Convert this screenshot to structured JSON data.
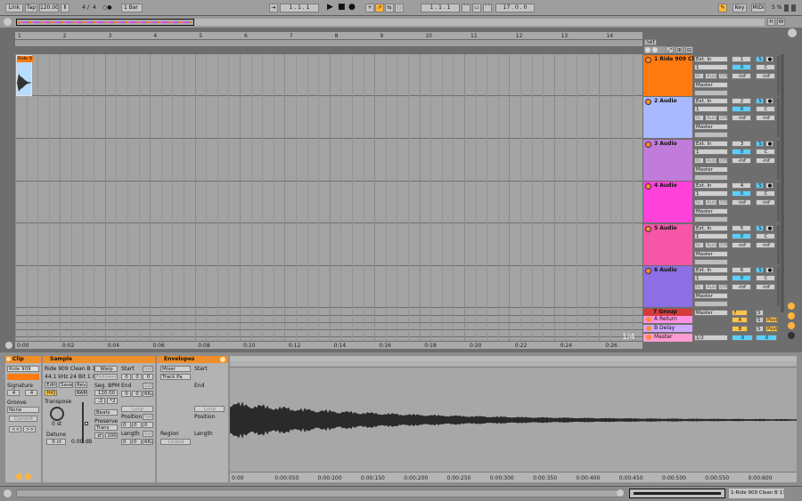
{
  "transport": {
    "link": "Link",
    "tap": "Tap",
    "tempo": "120.00",
    "sig_num": "4",
    "sig_sep": "/",
    "sig_den": "4",
    "metro": "○●",
    "quant": "1 Bar",
    "position": "1 .   1 .   1",
    "loop_start": "1 .   1 .   1",
    "loop_len": "17 .   0 .   0",
    "key": "Key",
    "midi": "MIDI",
    "cpu": "5 %",
    "h": "H",
    "w": "W"
  },
  "ruler": {
    "bars": [
      "1",
      "2",
      "3",
      "4",
      "5",
      "6",
      "7",
      "8",
      "9",
      "10",
      "11",
      "12",
      "13",
      "14"
    ],
    "times": [
      "0:00",
      "0:02",
      "0:04",
      "0:06",
      "0:08",
      "0:10",
      "0:12",
      "0:14",
      "0:16",
      "0:18",
      "0:20",
      "0:22",
      "0:24",
      "0:26"
    ],
    "set": "Set",
    "zoom": "1/4"
  },
  "clip_label": "Ride 9",
  "tracks": [
    {
      "name": "1 Ride 909 Cle",
      "color": "#ff7a10",
      "input": "Ext. In",
      "ch": "1",
      "num": "1",
      "vol": "0",
      "pan": "C",
      "inf1": "-inf",
      "inf2": "-inf",
      "out": "Master",
      "mon_in": "In",
      "mon_auto": "Auto",
      "mon_off": "Off"
    },
    {
      "name": "2 Audio",
      "color": "#a8b9ff",
      "input": "Ext. In",
      "ch": "1",
      "num": "2",
      "vol": "0",
      "pan": "C",
      "inf1": "-inf",
      "inf2": "-inf",
      "out": "Master",
      "mon_in": "In",
      "mon_auto": "Auto",
      "mon_off": "Off"
    },
    {
      "name": "3 Audio",
      "color": "#c07bdb",
      "input": "Ext. In",
      "ch": "1",
      "num": "3",
      "vol": "0",
      "pan": "C",
      "inf1": "-inf",
      "inf2": "-inf",
      "out": "Master",
      "mon_in": "In",
      "mon_auto": "Auto",
      "mon_off": "Off"
    },
    {
      "name": "4 Audio",
      "color": "#ff42d9",
      "input": "Ext. In",
      "ch": "1",
      "num": "4",
      "vol": "0",
      "pan": "C",
      "inf1": "-inf",
      "inf2": "-inf",
      "out": "Master",
      "mon_in": "In",
      "mon_auto": "Auto",
      "mon_off": "Off"
    },
    {
      "name": "5 Audio",
      "color": "#f556a6",
      "input": "Ext. In",
      "ch": "1",
      "num": "5",
      "vol": "0",
      "pan": "C",
      "inf1": "-inf",
      "inf2": "-inf",
      "out": "Master",
      "mon_in": "In",
      "mon_auto": "Auto",
      "mon_off": "Off"
    },
    {
      "name": "6 Audio",
      "color": "#8c6ee5",
      "input": "Ext. In",
      "ch": "1",
      "num": "6",
      "vol": "0",
      "pan": "C",
      "inf1": "-inf",
      "inf2": "-inf",
      "out": "Master",
      "mon_in": "In",
      "mon_auto": "Auto",
      "mon_off": "Off"
    }
  ],
  "group": {
    "name": "7 Group",
    "out": "Master",
    "num": "7",
    "s": "S"
  },
  "returns": [
    {
      "name": "A Return",
      "color": "#ff92e0",
      "letter": "A",
      "s": "S",
      "post": "Post"
    },
    {
      "name": "B Delay",
      "color": "#cfa9ff",
      "letter": "B",
      "s": "S",
      "post": "Post"
    }
  ],
  "master": {
    "name": "Master",
    "color": "#ff9bd2",
    "quant": "1/2",
    "vol": "0",
    "pan": "0"
  },
  "solo": "S",
  "clip": {
    "title": "Clip",
    "name": "Ride 909 Clea",
    "signature": "Signature",
    "sig_num": "4",
    "sig_den": "4",
    "groove": "Groove",
    "groove_val": "None",
    "commit": "Commit"
  },
  "sample": {
    "title": "Sample",
    "name": "Ride 909 Clean B 13",
    "info": "44.1 kHz 24 Bit 1 Ch",
    "warp": "Warp",
    "follower": "Follower",
    "edit": "Edit",
    "save": "Save",
    "rev": "Rev.",
    "seg_bpm": "Seg. BPM",
    "bpm": "120.00",
    "hiq": "HiQ",
    "ram": "RAM",
    "transpose": "Transpose",
    "transpose_val": "0 st",
    "detune": "Detune",
    "detune_val": "0 ct",
    "gain": "0.00 dB",
    "beats": "Beats",
    "preserve": "Preserve",
    "trans": "Trans",
    "rate": "100"
  },
  "pos": {
    "start": "Start",
    "set": "Set",
    "end": "End",
    "end_val": "662",
    "loop": "Loop",
    "position": "Position",
    "length": "Length",
    "length_val": "662",
    "zero": "0"
  },
  "envelopes": {
    "title": "Envelopes",
    "mixer": "Mixer",
    "trackpan": "Track Pa",
    "region": "Region",
    "linked": "Linked",
    "start": "Start",
    "end": "End",
    "loop": "Loop",
    "position": "Position",
    "length": "Length"
  },
  "sample_ruler": [
    "0:00",
    "0:00:050",
    "0:00:100",
    "0:00:150",
    "0:00:200",
    "0:00:250",
    "0:00:300",
    "0:00:350",
    "0:00:400",
    "0:00:450",
    "0:00:500",
    "0:00:550",
    "0:00:600"
  ],
  "status": {
    "track_label": "1-Ride 909 Clean B 13"
  }
}
